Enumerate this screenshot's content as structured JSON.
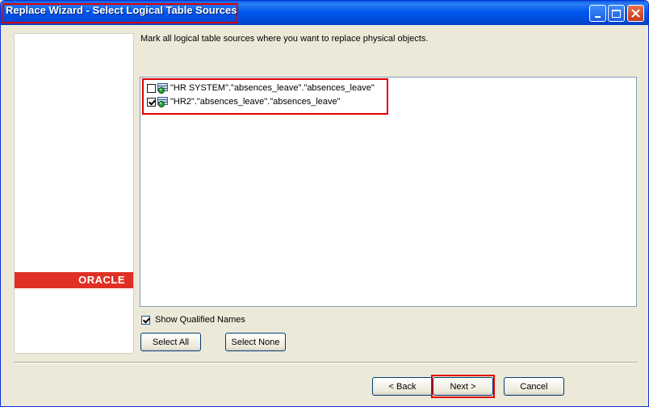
{
  "window": {
    "title": "Replace Wizard - Select Logical Table Sources",
    "controls": [
      "minimize-icon",
      "maximize-icon",
      "close-icon"
    ]
  },
  "brand": {
    "logo_text": "ORACLE",
    "color": "#e03025"
  },
  "main": {
    "instruction": "Mark all logical table sources where you want to replace physical objects.",
    "sources": [
      {
        "label": "\"HR SYSTEM\".\"absences_leave\".\"absences_leave\"",
        "checked": false
      },
      {
        "label": "\"HR2\".\"absences_leave\".\"absences_leave\"",
        "checked": true
      }
    ],
    "show_qualified": {
      "label": "Show Qualified Names",
      "checked": true
    },
    "select_all_label": "Select All",
    "select_none_label": "Select None"
  },
  "footer": {
    "back_label": "< Back",
    "next_label": "Next >",
    "cancel_label": "Cancel"
  },
  "highlight_color": "#e00000"
}
